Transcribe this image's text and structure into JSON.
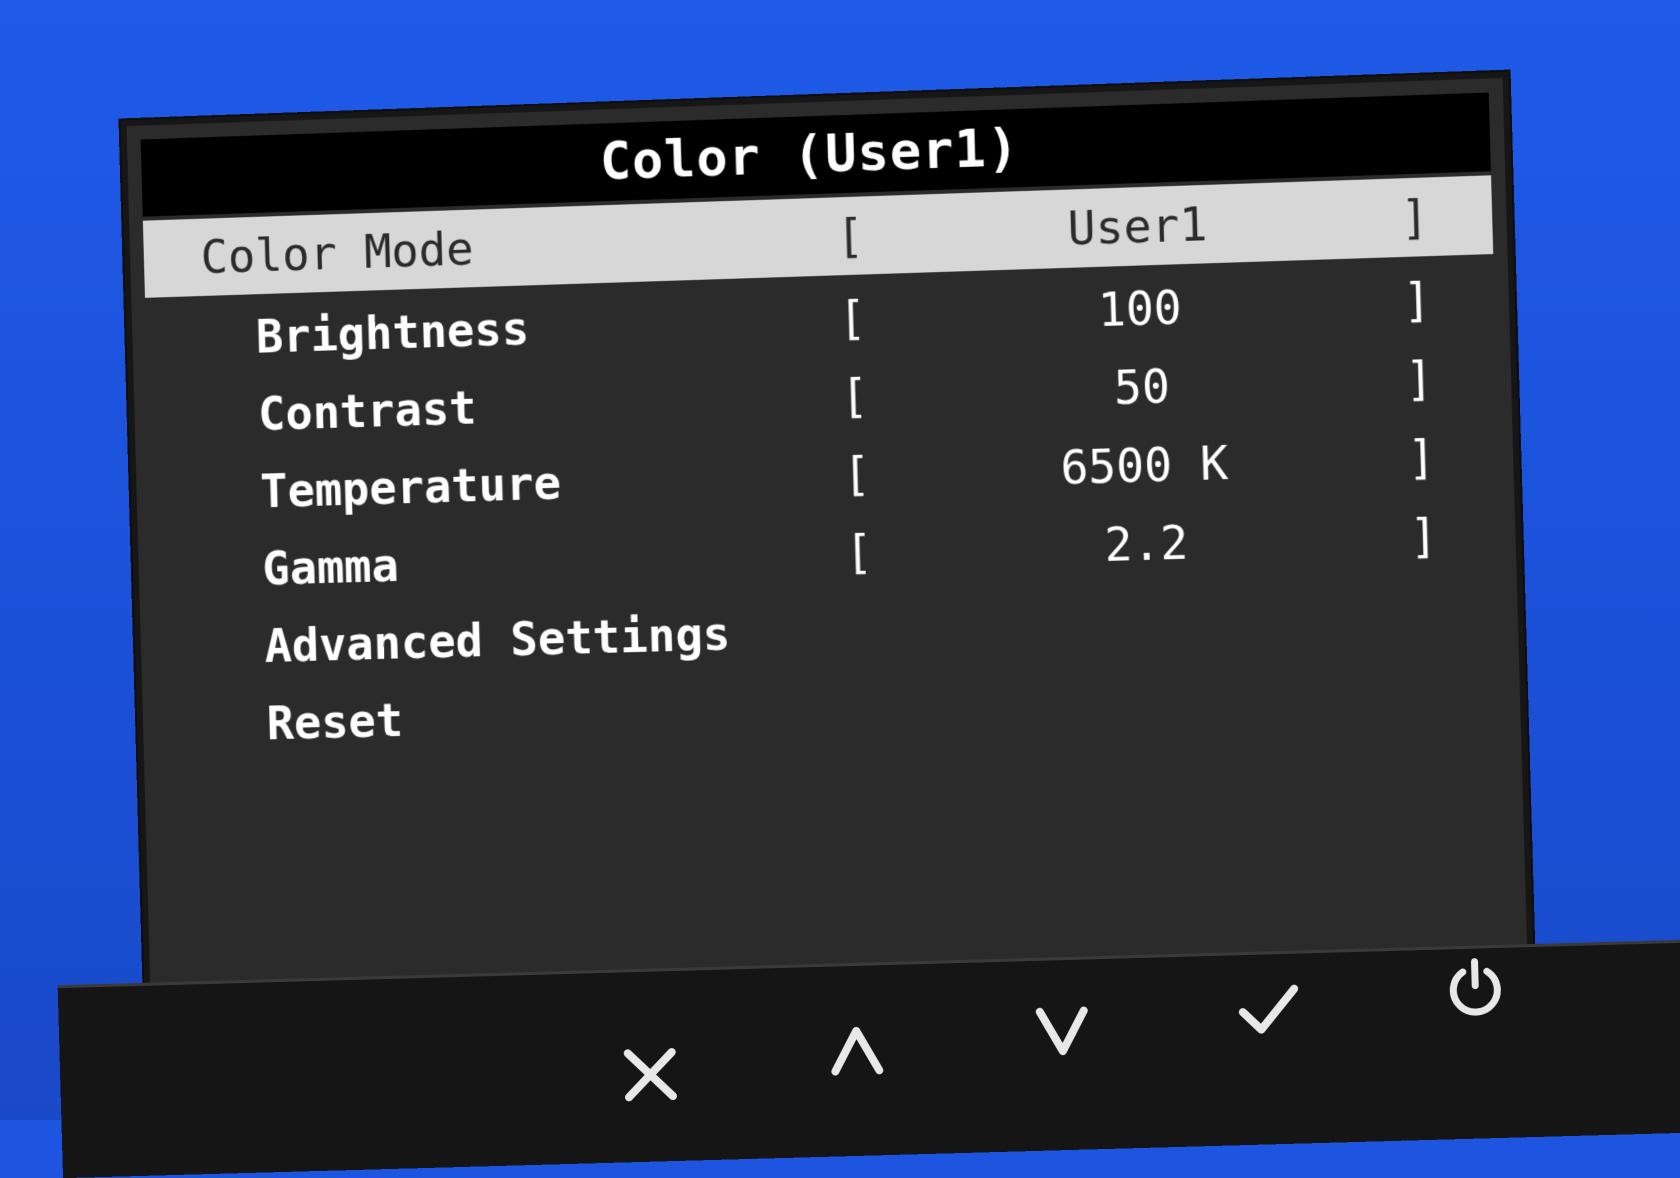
{
  "osd": {
    "title": "Color (User1)",
    "rows": [
      {
        "label": "Color Mode",
        "value": "User1",
        "selected": true
      },
      {
        "label": "Brightness",
        "value": "100"
      },
      {
        "label": "Contrast",
        "value": "50"
      },
      {
        "label": "Temperature",
        "value": "6500 K"
      },
      {
        "label": "Gamma",
        "value": "2.2"
      },
      {
        "label": "Advanced Settings"
      },
      {
        "label": "Reset"
      }
    ],
    "bracket_left": "[",
    "bracket_right": "]"
  },
  "buttons": [
    {
      "icon": "close-icon"
    },
    {
      "icon": "chevron-up-icon"
    },
    {
      "icon": "chevron-down-icon"
    },
    {
      "icon": "checkmark-icon"
    },
    {
      "icon": "power-icon"
    }
  ],
  "colors": {
    "screen_background": "#1d55e0",
    "osd_panel": "#2b2b2b",
    "title_bar": "#000000",
    "selected_row": "#d7d7d7",
    "text": "#ffffff"
  }
}
